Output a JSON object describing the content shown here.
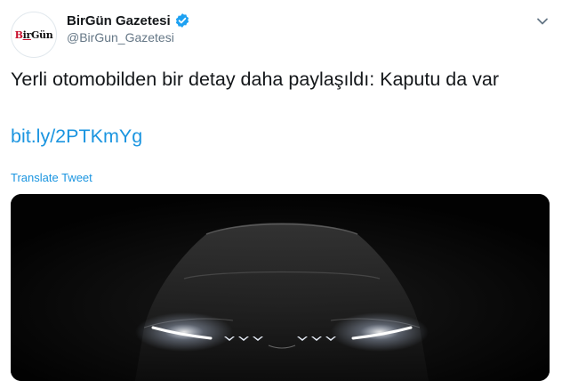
{
  "tweet": {
    "avatar_text": {
      "part1": "B",
      "part2": "ir",
      "part3": "Gün"
    },
    "display_name": "BirGün Gazetesi",
    "handle": "@BirGun_Gazetesi",
    "text": "Yerli otomobilden bir detay daha paylaşıldı: Kaputu da var",
    "link": "bit.ly/2PTKmYg",
    "translate_label": "Translate Tweet"
  },
  "colors": {
    "link_blue": "#1b95e0",
    "verified_blue": "#1da1f2",
    "avatar_red": "#c8102e"
  },
  "icons": {
    "verified": "verified-badge-icon",
    "more": "chevron-down-icon"
  }
}
